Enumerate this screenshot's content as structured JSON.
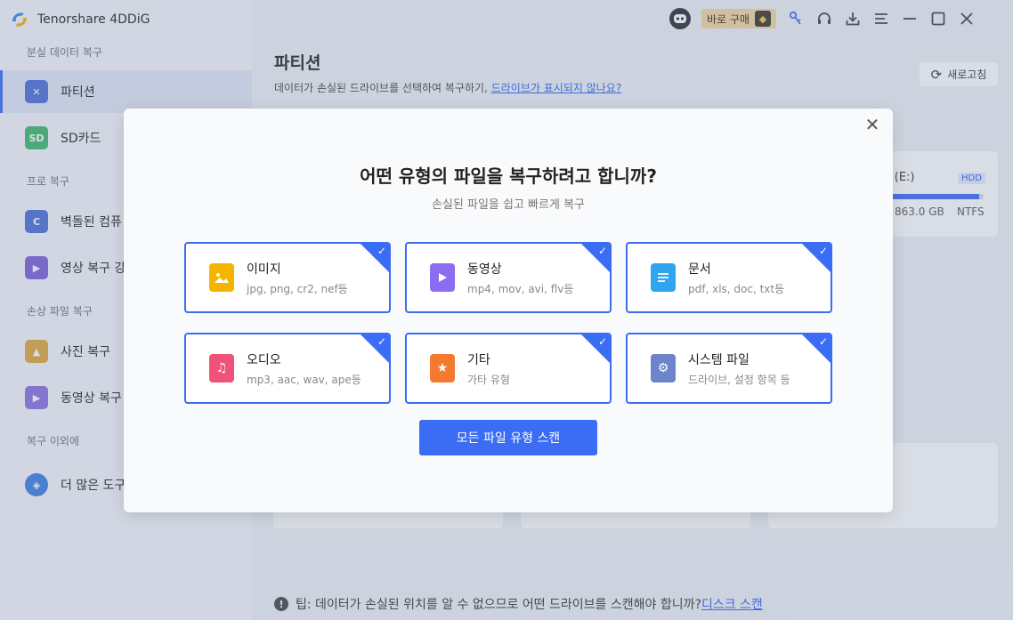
{
  "app": {
    "title": "Tenorshare 4DDiG"
  },
  "topbar": {
    "buy_label": "바로 구매"
  },
  "sidebar": {
    "sections": [
      {
        "label": "분실 데이터 복구",
        "items": [
          {
            "label": "파티션",
            "active": true
          },
          {
            "label": "SD카드"
          }
        ]
      },
      {
        "label": "프로 복구",
        "items": [
          {
            "label": "벽돌된 컴퓨"
          },
          {
            "label": "영상 복구 강"
          }
        ]
      },
      {
        "label": "손상 파일 복구",
        "items": [
          {
            "label": "사진 복구"
          },
          {
            "label": "동영상 복구"
          }
        ]
      },
      {
        "label": "복구 이외에",
        "items": [
          {
            "label": "더 많은 도구"
          }
        ]
      }
    ]
  },
  "main": {
    "title": "파티션",
    "subtitle": "데이터가 손실된 드라이브를 선택하여 복구하기, ",
    "subtitle_link": "드라이브가 표시되지 않나요?",
    "refresh_label": "새로고침",
    "drive": {
      "label": "ɨ (E:)",
      "badge": "HDD",
      "size": "863.0 GB",
      "fs": "NTFS",
      "used_fraction": 0.95
    },
    "tip_text": "팁: 데이터가 손실된 위치를 알 수 없으므로 어떤 드라이브를 스캔해야 합니까?",
    "tip_link": "디스크 스캔"
  },
  "modal": {
    "title": "어떤 유형의 파일을 복구하려고 합니까?",
    "subtitle": "손실된 파일을 쉽고 빠르게 복구",
    "types": [
      {
        "name": "이미지",
        "ext": "jpg, png, cr2, nef등",
        "icon": "image-icon",
        "color": "#f5b400",
        "checked": true
      },
      {
        "name": "동영상",
        "ext": "mp4, mov, avi, flv등",
        "icon": "video-icon",
        "color": "#8c6cf0",
        "checked": true
      },
      {
        "name": "문서",
        "ext": "pdf, xls, doc, txt등",
        "icon": "document-icon",
        "color": "#2fa5f0",
        "checked": true
      },
      {
        "name": "오디오",
        "ext": "mp3, aac, wav, ape등",
        "icon": "music-icon",
        "color": "#f0527a",
        "checked": true
      },
      {
        "name": "기타",
        "ext": "가타 유형",
        "icon": "star-icon",
        "color": "#f57a2f",
        "checked": true
      },
      {
        "name": "시스템 파일",
        "ext": "드라이브, 설정 항목 등",
        "icon": "gear-icon",
        "color": "#6b84cc",
        "checked": true
      }
    ],
    "scan_label": "모든 파일 유형 스캔"
  }
}
